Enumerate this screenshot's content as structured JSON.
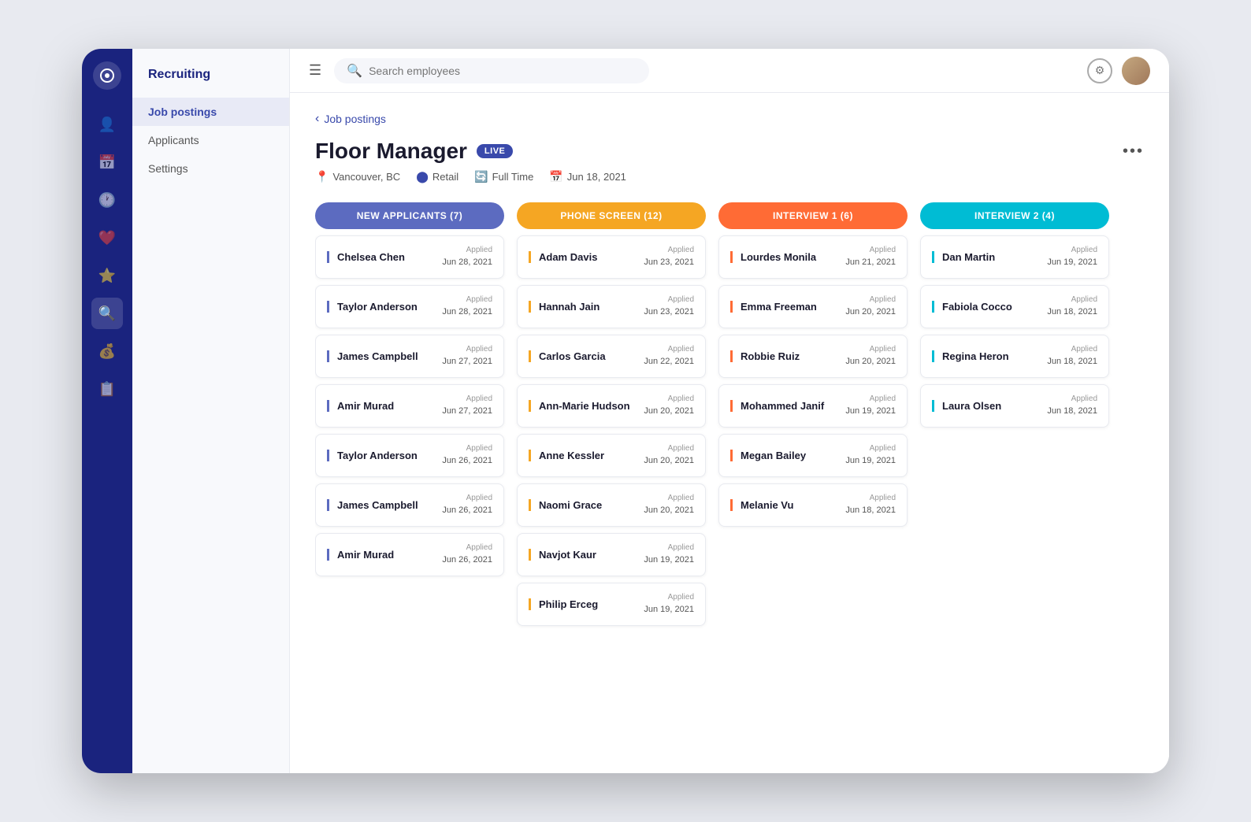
{
  "app": {
    "title": "Recruiting"
  },
  "topbar": {
    "search_placeholder": "Search employees",
    "menu_icon": "☰"
  },
  "left_nav": {
    "title": "Recruiting",
    "items": [
      {
        "id": "job-postings",
        "label": "Job postings",
        "active": true
      },
      {
        "id": "applicants",
        "label": "Applicants",
        "active": false
      },
      {
        "id": "settings",
        "label": "Settings",
        "active": false
      }
    ]
  },
  "breadcrumb": {
    "label": "Job postings"
  },
  "job": {
    "title": "Floor Manager",
    "status": "LIVE",
    "location": "Vancouver, BC",
    "department": "Retail",
    "type": "Full Time",
    "date": "Jun 18, 2021"
  },
  "columns": [
    {
      "id": "new-applicants",
      "label": "NEW APPLICANTS (7)",
      "color_class": "col-new",
      "card_border": "purple",
      "applicants": [
        {
          "name": "Chelsea Chen",
          "applied_date": "Jun 28, 2021"
        },
        {
          "name": "Taylor Anderson",
          "applied_date": "Jun 28, 2021"
        },
        {
          "name": "James Campbell",
          "applied_date": "Jun 27, 2021"
        },
        {
          "name": "Amir Murad",
          "applied_date": "Jun 27, 2021"
        },
        {
          "name": "Taylor Anderson",
          "applied_date": "Jun 26, 2021"
        },
        {
          "name": "James Campbell",
          "applied_date": "Jun 26, 2021"
        },
        {
          "name": "Amir Murad",
          "applied_date": "Jun 26, 2021"
        }
      ]
    },
    {
      "id": "phone-screen",
      "label": "PHONE SCREEN (12)",
      "color_class": "col-phone",
      "card_border": "orange",
      "applicants": [
        {
          "name": "Adam Davis",
          "applied_date": "Jun 23, 2021"
        },
        {
          "name": "Hannah Jain",
          "applied_date": "Jun 23, 2021"
        },
        {
          "name": "Carlos Garcia",
          "applied_date": "Jun 22, 2021"
        },
        {
          "name": "Ann-Marie Hudson",
          "applied_date": "Jun 20, 2021"
        },
        {
          "name": "Anne Kessler",
          "applied_date": "Jun 20, 2021"
        },
        {
          "name": "Naomi Grace",
          "applied_date": "Jun 20, 2021"
        },
        {
          "name": "Navjot Kaur",
          "applied_date": "Jun 19, 2021"
        },
        {
          "name": "Philip Erceg",
          "applied_date": "Jun 19, 2021"
        }
      ]
    },
    {
      "id": "interview-1",
      "label": "INTERVIEW 1 (6)",
      "color_class": "col-interview1",
      "card_border": "red",
      "applicants": [
        {
          "name": "Lourdes Monila",
          "applied_date": "Jun 21, 2021"
        },
        {
          "name": "Emma Freeman",
          "applied_date": "Jun 20, 2021"
        },
        {
          "name": "Robbie Ruiz",
          "applied_date": "Jun 20, 2021"
        },
        {
          "name": "Mohammed Janif",
          "applied_date": "Jun 19, 2021"
        },
        {
          "name": "Megan Bailey",
          "applied_date": "Jun 19, 2021"
        },
        {
          "name": "Melanie Vu",
          "applied_date": "Jun 18, 2021"
        }
      ]
    },
    {
      "id": "interview-2",
      "label": "INTERVIEW 2 (4)",
      "color_class": "col-interview2",
      "card_border": "cyan",
      "applicants": [
        {
          "name": "Dan Martin",
          "applied_date": "Jun 19, 2021"
        },
        {
          "name": "Fabiola Cocco",
          "applied_date": "Jun 18, 2021"
        },
        {
          "name": "Regina Heron",
          "applied_date": "Jun 18, 2021"
        },
        {
          "name": "Laura Olsen",
          "applied_date": "Jun 18, 2021"
        }
      ]
    }
  ],
  "icons": {
    "nav_icons": [
      "👤",
      "📅",
      "🕐",
      "❤️",
      "⭐",
      "🔍",
      "💰",
      "📋"
    ],
    "location_icon": "📍",
    "department_icon": "⬤",
    "type_icon": "🔄",
    "date_icon": "📅"
  },
  "labels": {
    "applied": "Applied"
  }
}
